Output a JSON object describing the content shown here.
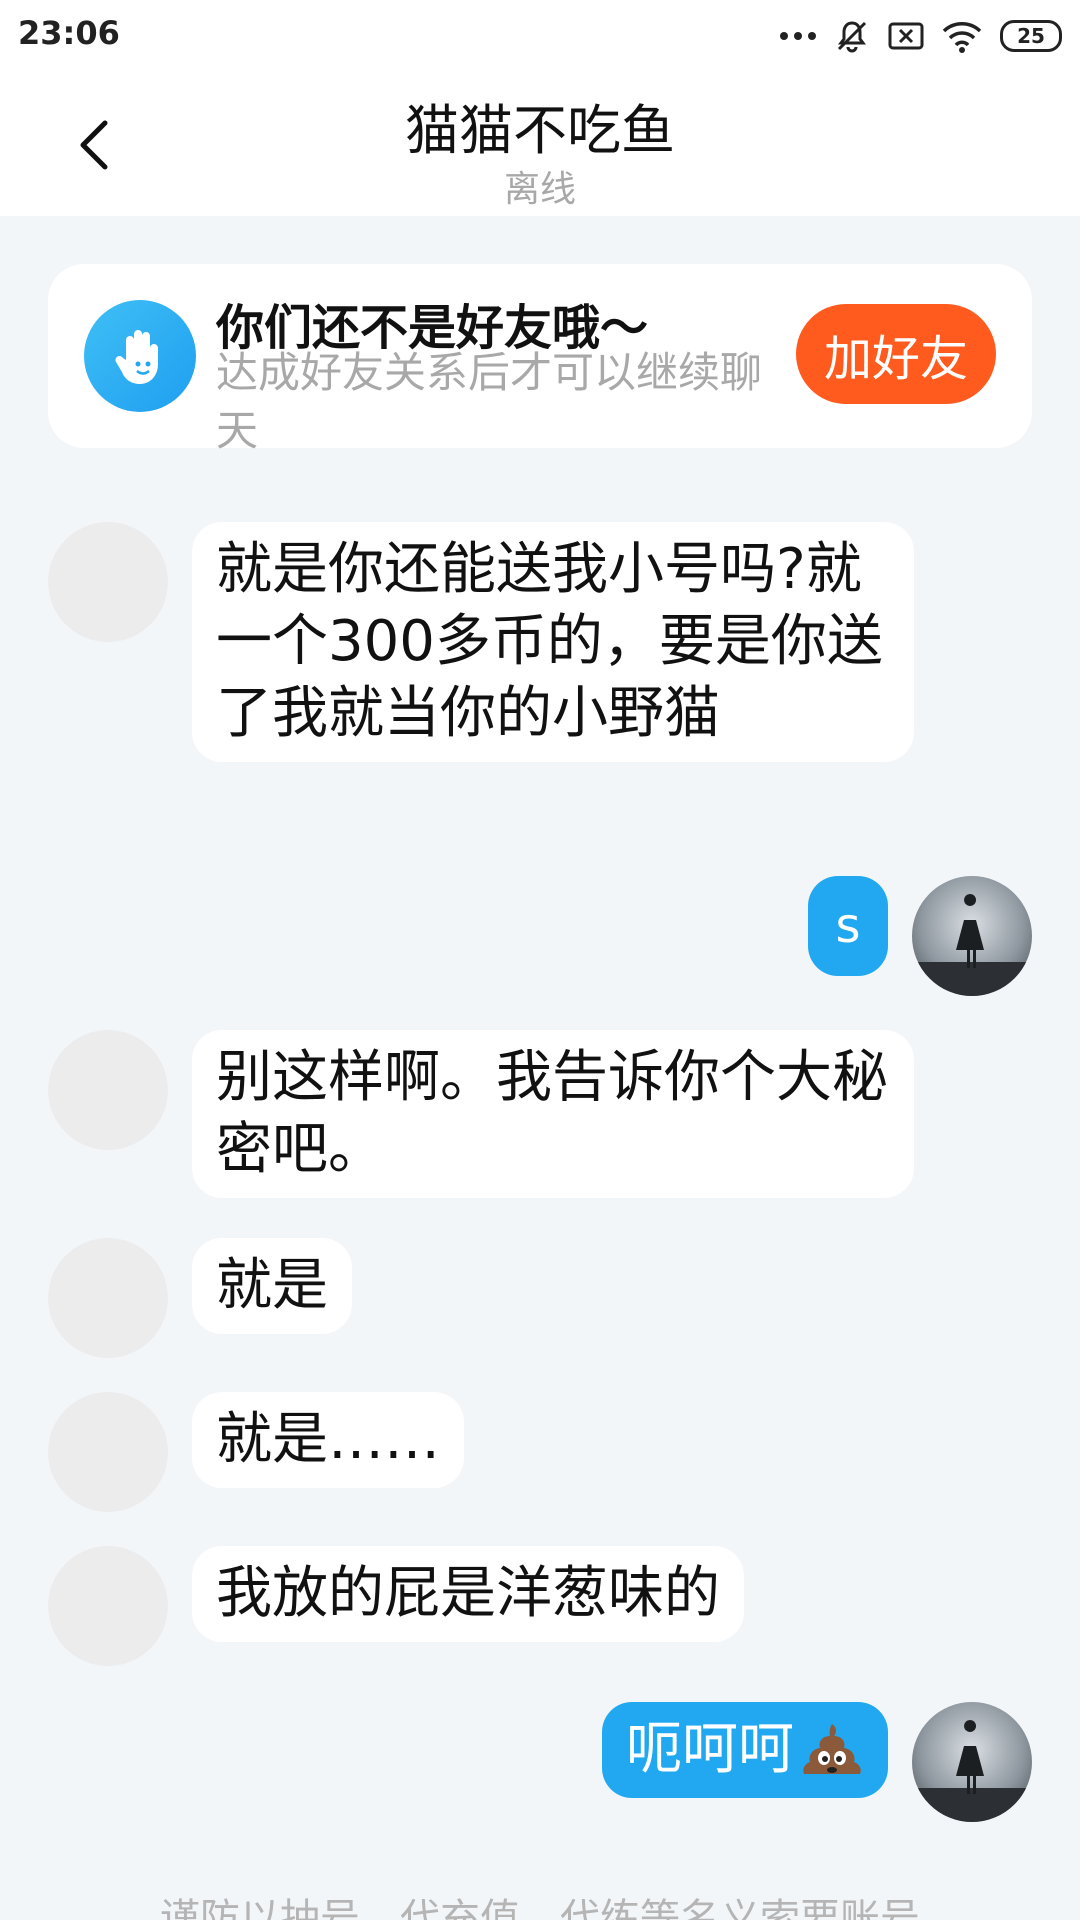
{
  "status_bar": {
    "time": "23:06",
    "battery": "25",
    "icons": [
      "more-dots-icon",
      "mute-bell-icon",
      "sim-error-icon",
      "wifi-icon",
      "battery-icon"
    ]
  },
  "header": {
    "title": "猫猫不吃鱼",
    "subtitle": "离线",
    "back_icon": "chevron-left-icon"
  },
  "friend_card": {
    "title": "你们还不是好友哦～",
    "desc": "达成好友关系后才可以继续聊天",
    "button": "加好友",
    "icon": "hand-wave-icon"
  },
  "messages": [
    {
      "side": "left",
      "text": "就是你还能送我小号吗?就一个300多币的，要是你送了我就当你的小野猫"
    },
    {
      "side": "right",
      "text": "s"
    },
    {
      "side": "left",
      "text": "别这样啊。我告诉你个大秘密吧。"
    },
    {
      "side": "left",
      "text": "就是"
    },
    {
      "side": "left",
      "text": "就是……"
    },
    {
      "side": "left",
      "text": "我放的屁是洋葱味的"
    },
    {
      "side": "right",
      "text": "呃呵呵",
      "emoji": "poop-icon"
    }
  ],
  "footer": {
    "notice": "谨防以抽号、代充值、代练等名义索要账号"
  },
  "colors": {
    "accent_blue": "#22a8f0",
    "add_friend_orange": "#ff5b1e",
    "background": "#f3f6f9"
  }
}
